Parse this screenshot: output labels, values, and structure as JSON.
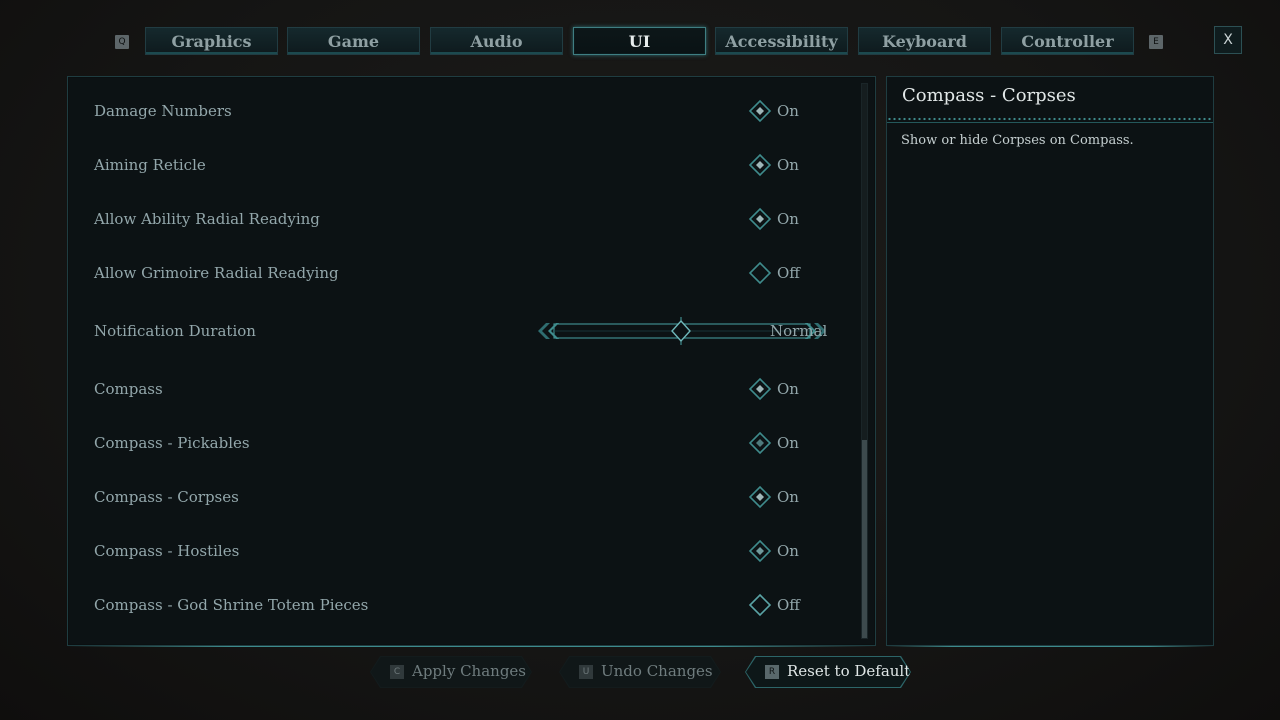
{
  "tabbar": {
    "left_key": "Q",
    "right_key": "E",
    "tabs": [
      {
        "label": "Graphics",
        "active": false
      },
      {
        "label": "Game",
        "active": false
      },
      {
        "label": "Audio",
        "active": false
      },
      {
        "label": "UI",
        "active": true
      },
      {
        "label": "Accessibility",
        "active": false
      },
      {
        "label": "Keyboard",
        "active": false
      },
      {
        "label": "Controller",
        "active": false
      }
    ],
    "close_label": "X"
  },
  "settings": {
    "rows": [
      {
        "label": "Damage Numbers",
        "value": "On"
      },
      {
        "label": "Aiming Reticle",
        "value": "On"
      },
      {
        "label": "Allow Ability Radial Readying",
        "value": "On"
      },
      {
        "label": "Allow Grimoire Radial Readying",
        "value": "Off"
      },
      {
        "label": "Notification Duration",
        "value": "Normal"
      },
      {
        "label": "Compass",
        "value": "On"
      },
      {
        "label": "Compass - Pickables",
        "value": "On"
      },
      {
        "label": "Compass - Corpses",
        "value": "On"
      },
      {
        "label": "Compass - Hostiles",
        "value": "On"
      },
      {
        "label": "Compass - God Shrine Totem Pieces",
        "value": "Off"
      }
    ],
    "slider_fraction": 0.5
  },
  "description": {
    "title": "Compass - Corpses",
    "text": "Show or hide Corpses on Compass."
  },
  "footer": {
    "apply": {
      "key": "C",
      "label": "Apply Changes"
    },
    "undo": {
      "key": "U",
      "label": "Undo Changes"
    },
    "reset": {
      "key": "R",
      "label": "Reset to Default"
    }
  },
  "colors": {
    "accent": "#3f8b8c",
    "panel_bg": "#0c1214",
    "text": "#93a7ab"
  }
}
